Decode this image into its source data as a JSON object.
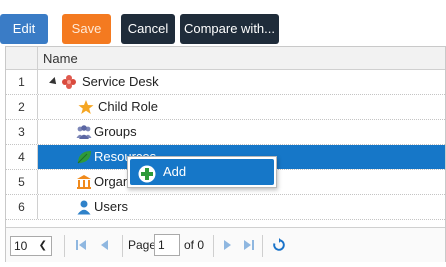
{
  "toolbar": {
    "edit_label": "Edit",
    "save_label": "Save",
    "cancel_label": "Cancel",
    "compare_label": "Compare with..."
  },
  "grid": {
    "header": {
      "name_column": "Name"
    },
    "rows": [
      {
        "num": "1",
        "label": "Service Desk",
        "icon": "service-desk-icon"
      },
      {
        "num": "2",
        "label": "Child Role",
        "icon": "star-icon"
      },
      {
        "num": "3",
        "label": "Groups",
        "icon": "groups-icon"
      },
      {
        "num": "4",
        "label": "Resources",
        "icon": "leaf-icon",
        "selected": true
      },
      {
        "num": "5",
        "label": "Organization",
        "icon": "organization-icon"
      },
      {
        "num": "6",
        "label": "Users",
        "icon": "user-icon"
      }
    ]
  },
  "context_menu": {
    "items": [
      {
        "label": "Add",
        "icon": "add-icon"
      }
    ]
  },
  "pager": {
    "page_size": "10",
    "page_label": "Page",
    "page_value": "1",
    "of_label": "of 0"
  },
  "colors": {
    "edit_button": "#3a7cc6",
    "save_button": "#f47a20",
    "dark_button": "#1f2c3a",
    "selection": "#1677c8",
    "pager_icons": "#8fb7e0",
    "refresh_icon": "#1a73c9"
  }
}
